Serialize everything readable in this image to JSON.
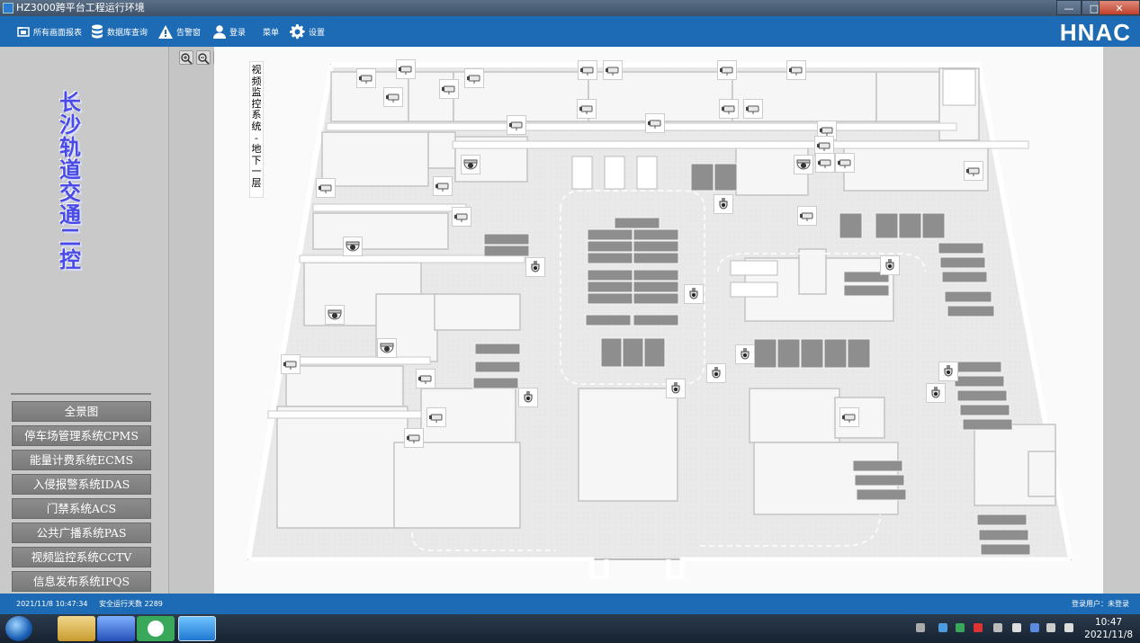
{
  "window": {
    "title": "HZ3000跨平台工程运行环境",
    "minimize": "—",
    "maximize": "□",
    "close": "✕"
  },
  "menu": {
    "items": [
      {
        "label": "所有画面报表",
        "icon": "report-icon"
      },
      {
        "label": "数据库查询",
        "icon": "database-icon"
      },
      {
        "label": "告警窗",
        "icon": "warning-icon"
      },
      {
        "label": "登录",
        "icon": "user-icon"
      },
      {
        "label": "菜单",
        "icon": ""
      },
      {
        "label": "设置",
        "icon": "gear-icon"
      }
    ],
    "logo": "HNAC"
  },
  "sidebar": {
    "title": "长沙轨道交通二控",
    "nav": [
      "全景图",
      "停车场管理系统CPMS",
      "能量计费系统ECMS",
      "入侵报警系统IDAS",
      "门禁系统ACS",
      "公共广播系统PAS",
      "视频监控系统CCTV",
      "信息发布系统IPQS"
    ]
  },
  "map": {
    "floor_label": "视频监控系统-地下一层",
    "zoom_tools": [
      "zoom-in-icon",
      "zoom-out-icon",
      "zoom-reset-icon"
    ]
  },
  "status": {
    "datetime": "2021/11/8 10:47:34",
    "safe_days": "安全运行天数 2289",
    "login_user": "登录用户：未登录"
  },
  "taskbar": {
    "time": "10:47",
    "date": "2021/11/8"
  },
  "colors": {
    "brand_blue": "#1d6bb5",
    "title_purple": "#4a4ae6",
    "nav_gray": "#848484"
  }
}
